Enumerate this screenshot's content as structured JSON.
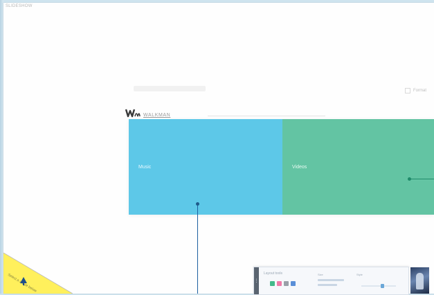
{
  "header": {
    "corner_label": "SLIDESHOW"
  },
  "top_right": {
    "checkbox_label": "Format"
  },
  "logo": {
    "wordmark": "WALKMAN"
  },
  "blocks": [
    {
      "label": "Music",
      "color": "#5dc8e8"
    },
    {
      "label": "Videos",
      "color": "#63c4a3"
    }
  ],
  "toolbar": {
    "title": "Layout tools",
    "swatch_colors": [
      "#43b98a",
      "#f07aa8",
      "#9aa0a8",
      "#5a8fd8"
    ],
    "col1_label": "Size",
    "col2_label": "Style"
  },
  "corner": {
    "caption": "Select a shape below",
    "color": "#fff05c"
  }
}
